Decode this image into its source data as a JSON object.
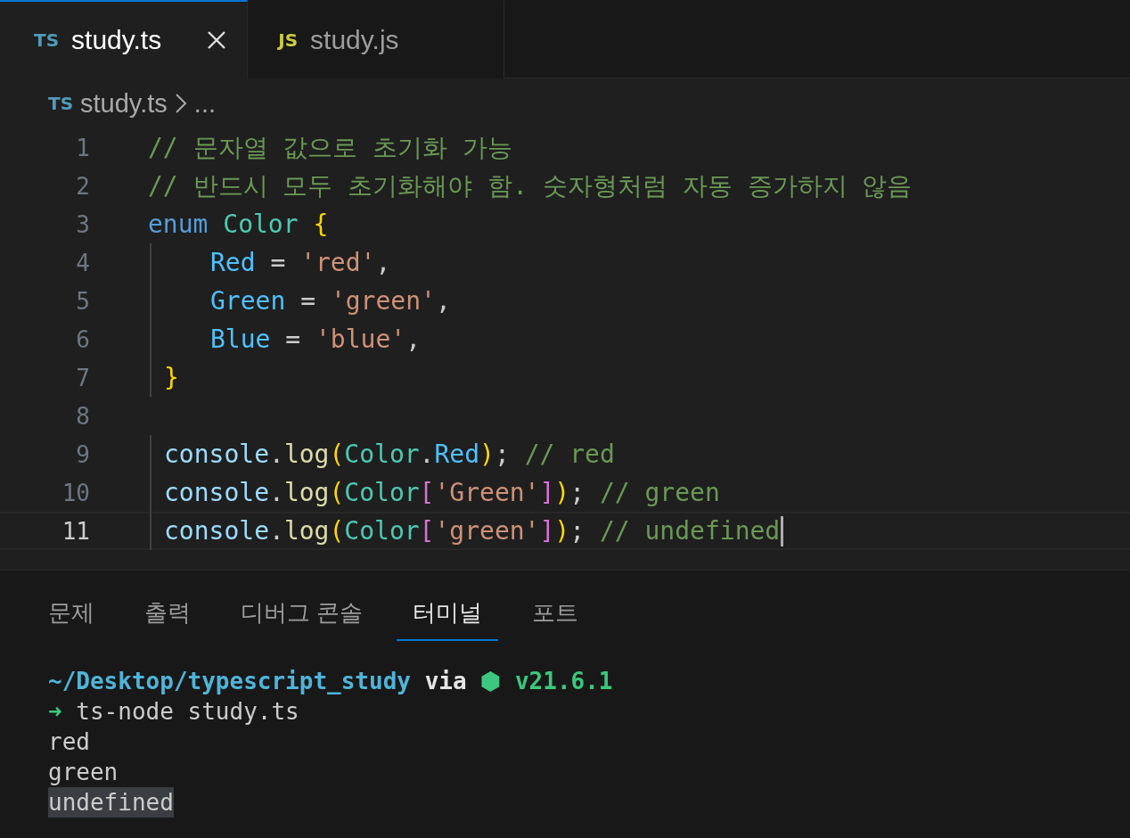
{
  "tabs": [
    {
      "icon": "TS",
      "label": "study.ts",
      "selected": true
    },
    {
      "icon": "JS",
      "label": "study.js",
      "selected": false
    }
  ],
  "breadcrumb": {
    "icon": "TS",
    "file": "study.ts",
    "more": "..."
  },
  "editor": {
    "lines": [
      {
        "number": "1",
        "current": false,
        "indent_guide": false,
        "tokens": [
          {
            "kind": "comment",
            "text": "// 문자열 값으로 초기화 가능"
          }
        ]
      },
      {
        "number": "2",
        "current": false,
        "indent_guide": false,
        "tokens": [
          {
            "kind": "comment",
            "text": "// 반드시 모두 초기화해야 함. 숫자형처럼 자동 증가하지 않음"
          }
        ]
      },
      {
        "number": "3",
        "current": false,
        "indent_guide": false,
        "tokens": [
          {
            "kind": "keyword",
            "text": "enum "
          },
          {
            "kind": "type",
            "text": "Color "
          },
          {
            "kind": "bracket1",
            "text": "{"
          }
        ]
      },
      {
        "number": "4",
        "current": false,
        "indent_guide": true,
        "nested": true,
        "tokens": [
          {
            "kind": "member",
            "text": "Red"
          },
          {
            "kind": "plain",
            "text": " = "
          },
          {
            "kind": "string",
            "text": "'red'"
          },
          {
            "kind": "plain",
            "text": ","
          }
        ]
      },
      {
        "number": "5",
        "current": false,
        "indent_guide": true,
        "nested": true,
        "tokens": [
          {
            "kind": "member",
            "text": "Green"
          },
          {
            "kind": "plain",
            "text": " = "
          },
          {
            "kind": "string",
            "text": "'green'"
          },
          {
            "kind": "plain",
            "text": ","
          }
        ]
      },
      {
        "number": "6",
        "current": false,
        "indent_guide": true,
        "nested": true,
        "tokens": [
          {
            "kind": "member",
            "text": "Blue"
          },
          {
            "kind": "plain",
            "text": " = "
          },
          {
            "kind": "string",
            "text": "'blue'"
          },
          {
            "kind": "plain",
            "text": ","
          }
        ]
      },
      {
        "number": "7",
        "current": false,
        "indent_guide": true,
        "tokens": [
          {
            "kind": "bracket1",
            "text": "}"
          }
        ]
      },
      {
        "number": "8",
        "current": false,
        "indent_guide": false
      },
      {
        "number": "9",
        "current": false,
        "indent_guide": true,
        "tokens": [
          {
            "kind": "variable",
            "text": "console"
          },
          {
            "kind": "plain",
            "text": "."
          },
          {
            "kind": "func",
            "text": "log"
          },
          {
            "kind": "bracket1",
            "text": "("
          },
          {
            "kind": "type",
            "text": "Color"
          },
          {
            "kind": "plain",
            "text": "."
          },
          {
            "kind": "member",
            "text": "Red"
          },
          {
            "kind": "bracket1",
            "text": ")"
          },
          {
            "kind": "plain",
            "text": "; "
          },
          {
            "kind": "comment",
            "text": "// red"
          }
        ]
      },
      {
        "number": "10",
        "current": false,
        "indent_guide": true,
        "tokens": [
          {
            "kind": "variable",
            "text": "console"
          },
          {
            "kind": "plain",
            "text": "."
          },
          {
            "kind": "func",
            "text": "log"
          },
          {
            "kind": "bracket1",
            "text": "("
          },
          {
            "kind": "type",
            "text": "Color"
          },
          {
            "kind": "bracket2",
            "text": "["
          },
          {
            "kind": "string",
            "text": "'Green'"
          },
          {
            "kind": "bracket2",
            "text": "]"
          },
          {
            "kind": "bracket1",
            "text": ")"
          },
          {
            "kind": "plain",
            "text": "; "
          },
          {
            "kind": "comment",
            "text": "// green"
          }
        ]
      },
      {
        "number": "11",
        "current": true,
        "indent_guide": true,
        "tokens": [
          {
            "kind": "variable",
            "text": "console"
          },
          {
            "kind": "plain",
            "text": "."
          },
          {
            "kind": "func",
            "text": "log"
          },
          {
            "kind": "bracket1",
            "text": "("
          },
          {
            "kind": "type",
            "text": "Color"
          },
          {
            "kind": "bracket2",
            "text": "["
          },
          {
            "kind": "string",
            "text": "'green'"
          },
          {
            "kind": "bracket2",
            "text": "]"
          },
          {
            "kind": "bracket1",
            "text": ")"
          },
          {
            "kind": "plain",
            "text": "; "
          },
          {
            "kind": "comment",
            "text": "// undefined"
          }
        ]
      }
    ]
  },
  "panel": {
    "tabs": [
      {
        "label": "문제",
        "selected": false
      },
      {
        "label": "출력",
        "selected": false
      },
      {
        "label": "디버그 콘솔",
        "selected": false
      },
      {
        "label": "터미널",
        "selected": true
      },
      {
        "label": "포트",
        "selected": false
      }
    ],
    "terminal": {
      "lines": [
        {
          "selected": false,
          "segments": [
            {
              "kind": "path",
              "text": "~/Desktop/typescript_study"
            },
            {
              "kind": "bold",
              "text": " via "
            },
            {
              "kind": "version",
              "text": "⬢ v21.6.1"
            }
          ]
        },
        {
          "selected": false,
          "segments": [
            {
              "kind": "arrow",
              "text": "➜"
            },
            {
              "kind": "plain",
              "text": " ts-node study.ts"
            }
          ]
        },
        {
          "selected": false,
          "segments": [
            {
              "kind": "plain",
              "text": "red"
            }
          ]
        },
        {
          "selected": false,
          "segments": [
            {
              "kind": "plain",
              "text": "green"
            }
          ]
        },
        {
          "selected": true,
          "segments": [
            {
              "kind": "plain",
              "text": "undefined"
            }
          ]
        }
      ]
    }
  }
}
